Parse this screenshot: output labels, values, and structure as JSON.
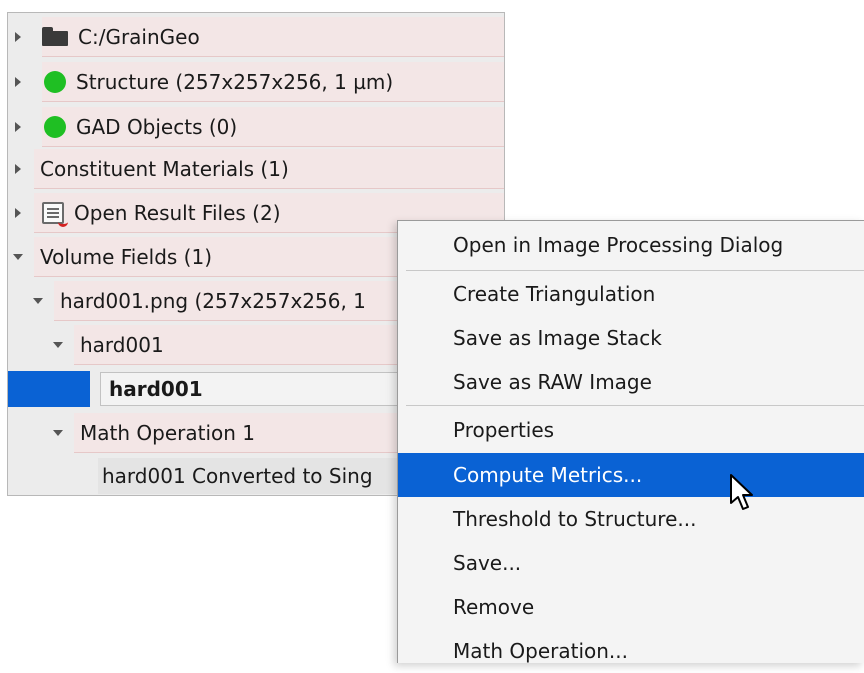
{
  "tree": {
    "items": [
      {
        "label": "C:/GrainGeo",
        "icon": "folder-icon",
        "expander": "collapsed"
      },
      {
        "label": "Structure (257x257x256, 1 µm)",
        "icon": "green-status-icon",
        "expander": "collapsed"
      },
      {
        "label": "GAD Objects (0)",
        "icon": "green-status-icon",
        "expander": "collapsed"
      },
      {
        "label": "Constituent Materials (1)",
        "icon": "",
        "expander": "collapsed"
      },
      {
        "label": "Open Result Files (2)",
        "icon": "result-file-icon",
        "expander": "collapsed"
      },
      {
        "label": "Volume Fields (1)",
        "icon": "",
        "expander": "expanded"
      },
      {
        "label": "hard001.png (257x257x256, 1",
        "icon": "",
        "expander": "expanded"
      },
      {
        "label": "hard001",
        "icon": "",
        "expander": "expanded"
      },
      {
        "label": "hard001",
        "icon": "",
        "expander": "none",
        "selected": true
      },
      {
        "label": "Math Operation 1",
        "icon": "",
        "expander": "expanded"
      },
      {
        "label": "hard001 Converted to Sing",
        "icon": "",
        "expander": "none"
      }
    ]
  },
  "context_menu": {
    "items": [
      {
        "label": "Open in Image Processing Dialog"
      },
      {
        "label": "Create Triangulation"
      },
      {
        "label": "Save as Image Stack"
      },
      {
        "label": "Save as RAW Image"
      },
      {
        "label": "Properties"
      },
      {
        "label": "Compute Metrics...",
        "highlighted": true
      },
      {
        "label": "Threshold to Structure..."
      },
      {
        "label": "Save..."
      },
      {
        "label": "Remove"
      },
      {
        "label": "Math Operation..."
      }
    ]
  },
  "colors": {
    "selection": "#0a62d4",
    "status_green": "#1fbf23",
    "row_band": "#f3e6e6"
  }
}
